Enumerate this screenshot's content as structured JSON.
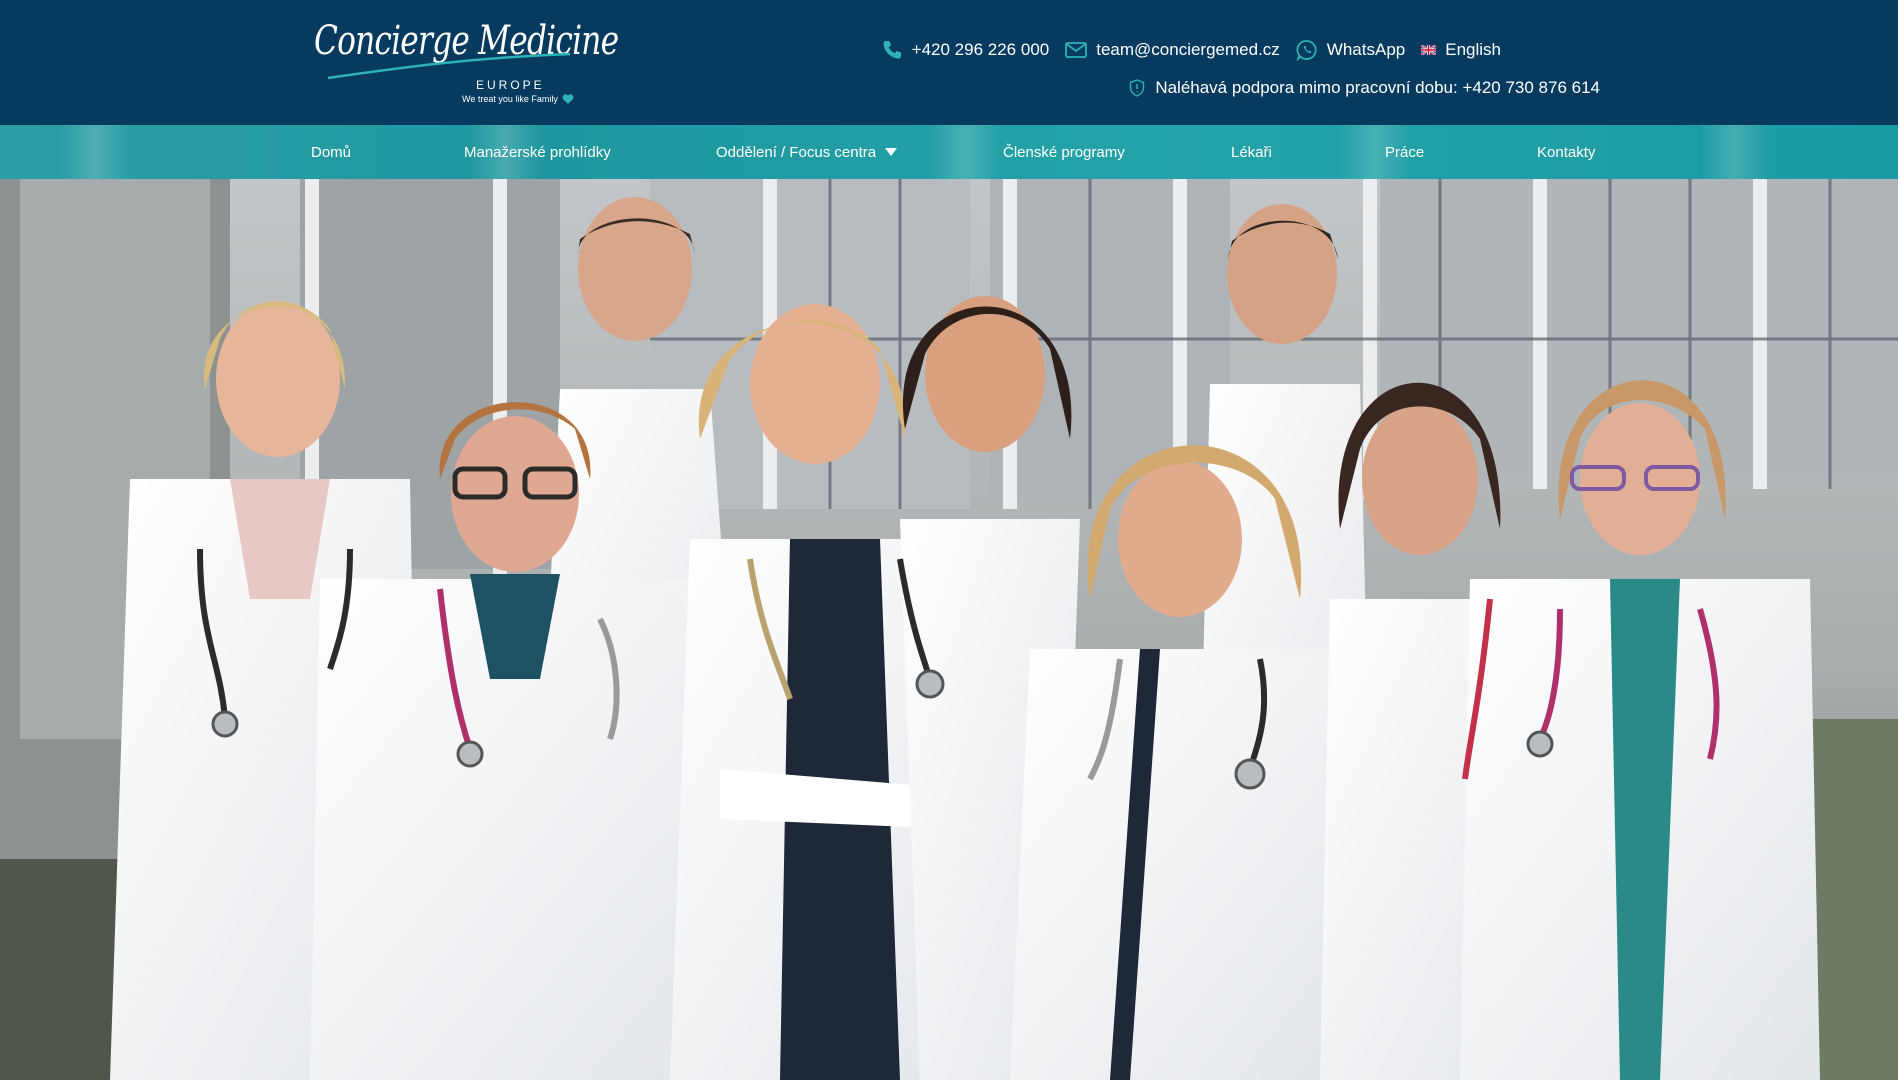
{
  "brand": {
    "name_script": "Concierge Medicine",
    "sub": "EUROPE",
    "tagline": "We treat you like Family"
  },
  "contacts": {
    "phone": "+420 296 226 000",
    "email": "team@conciergemed.cz",
    "whatsapp": "WhatsApp",
    "language": "English",
    "urgent": "Naléhavá podpora mimo pracovní dobu: +420 730 876 614"
  },
  "nav": {
    "items": [
      {
        "label": "Domů"
      },
      {
        "label": "Manažerské prohlídky"
      },
      {
        "label": "Oddělení / Focus centra"
      },
      {
        "label": "Členské programy"
      },
      {
        "label": "Lékaři"
      },
      {
        "label": "Práce"
      },
      {
        "label": "Kontakty"
      }
    ]
  },
  "colors": {
    "header_bg": "#063a5f",
    "nav_bg": "#1f979e",
    "accent": "#2bb3b8",
    "text": "#ffffff"
  },
  "icons": {
    "phone": "phone-icon",
    "email": "envelope-icon",
    "whatsapp": "whatsapp-icon",
    "language": "uk-flag-icon",
    "urgent": "shield-icon",
    "dropdown": "caret-down-icon"
  }
}
